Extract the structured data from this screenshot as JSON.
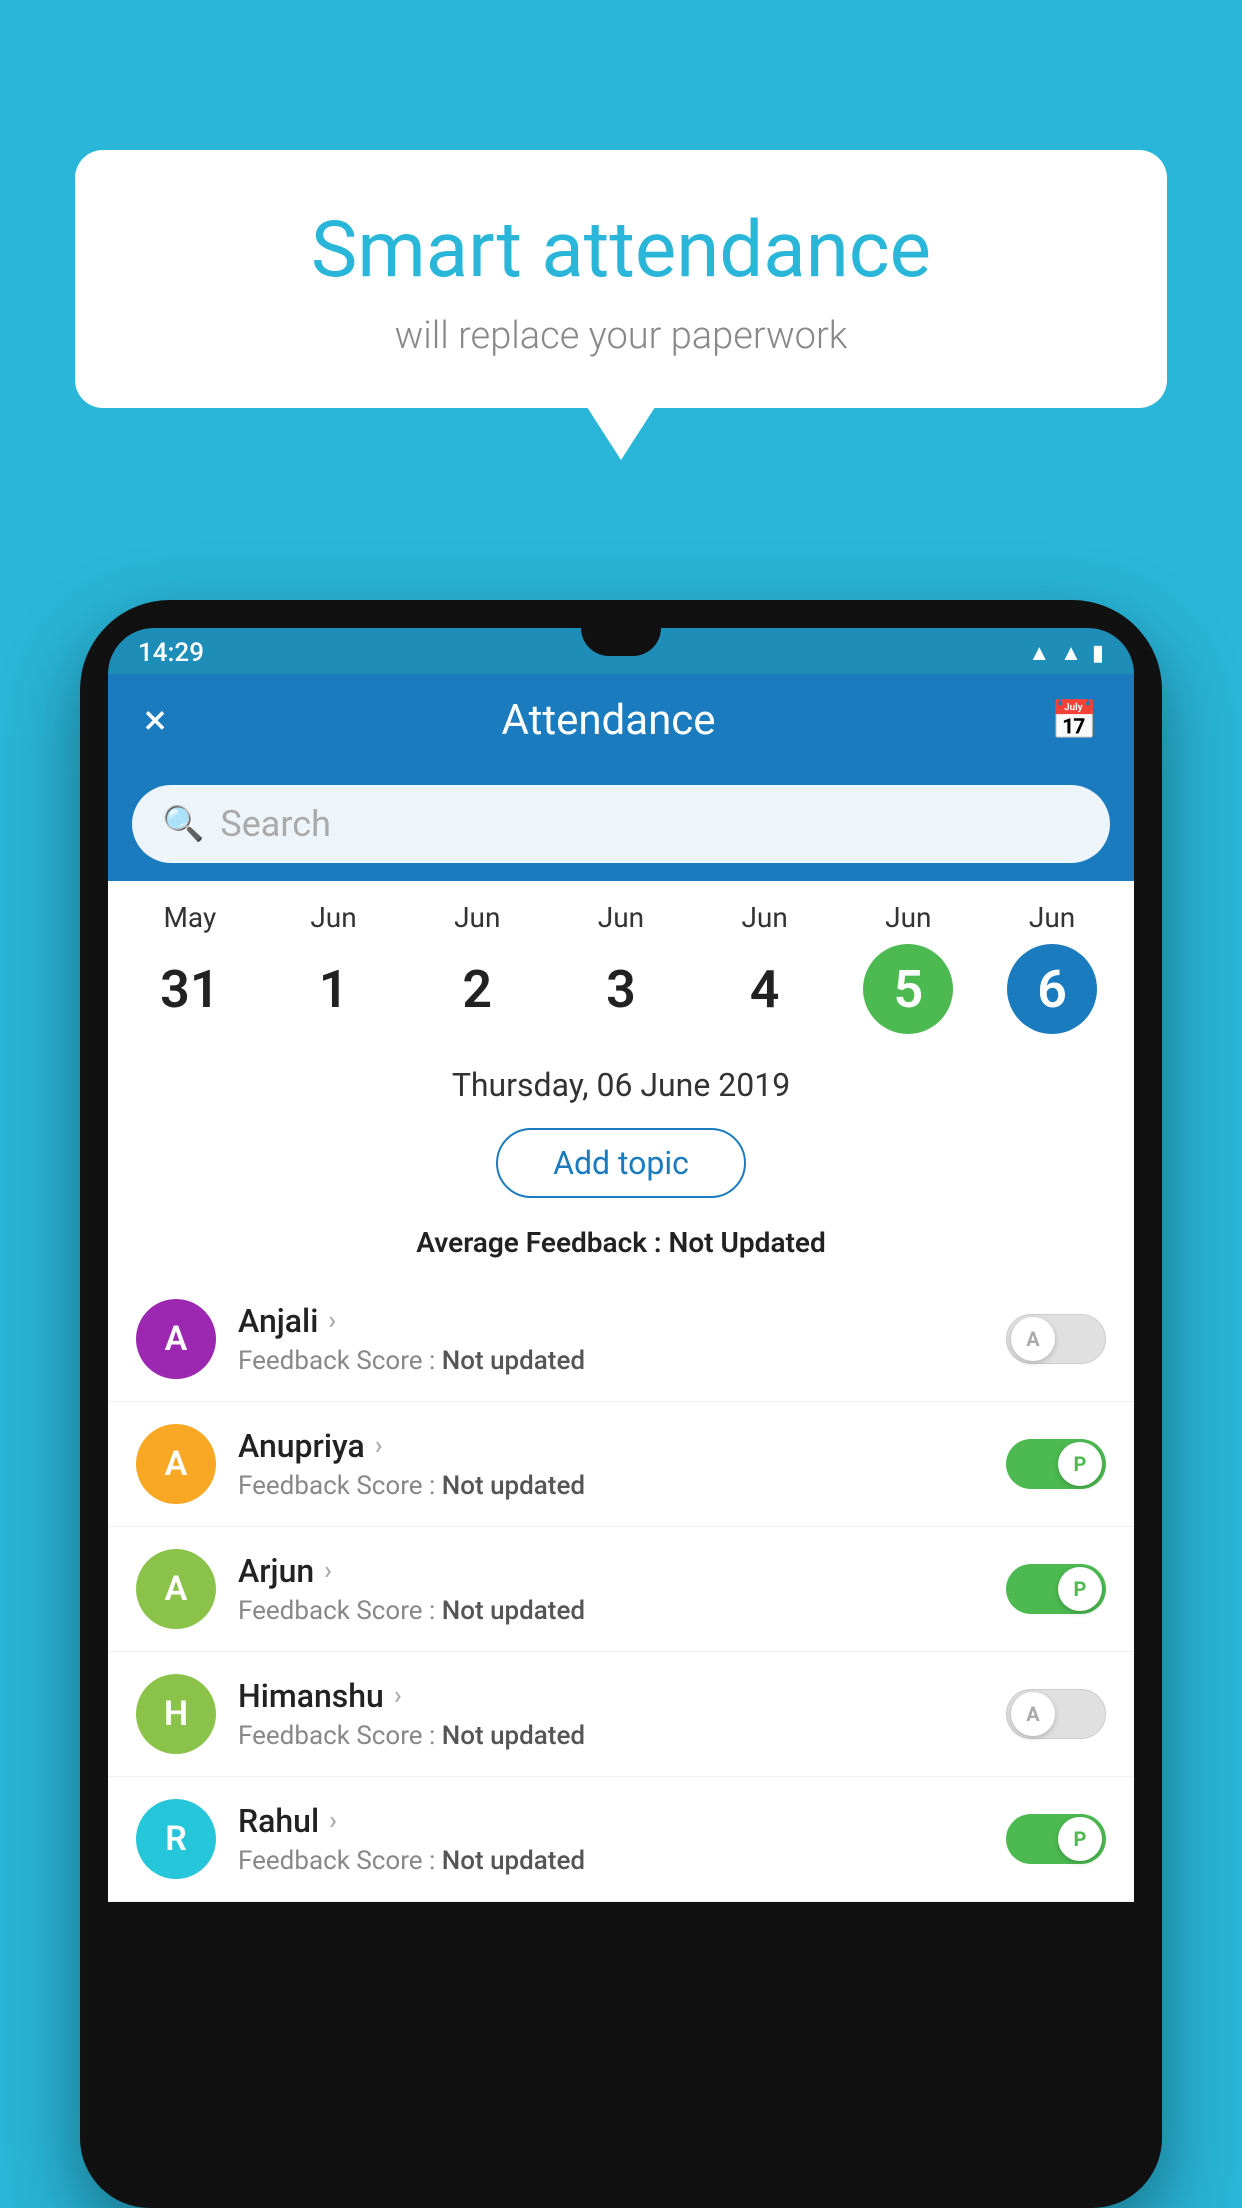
{
  "background_color": "#29b6d8",
  "bubble": {
    "title": "Smart attendance",
    "subtitle": "will replace your paperwork"
  },
  "phone": {
    "time": "14:29",
    "header": {
      "title": "Attendance",
      "close_icon": "×",
      "calendar_icon": "📅"
    },
    "search": {
      "placeholder": "Search"
    },
    "calendar": {
      "days": [
        {
          "month": "May",
          "date": "31",
          "state": "normal"
        },
        {
          "month": "Jun",
          "date": "1",
          "state": "normal"
        },
        {
          "month": "Jun",
          "date": "2",
          "state": "normal"
        },
        {
          "month": "Jun",
          "date": "3",
          "state": "normal"
        },
        {
          "month": "Jun",
          "date": "4",
          "state": "normal"
        },
        {
          "month": "Jun",
          "date": "5",
          "state": "today"
        },
        {
          "month": "Jun",
          "date": "6",
          "state": "selected"
        }
      ]
    },
    "selected_date": "Thursday, 06 June 2019",
    "add_topic_label": "Add topic",
    "avg_feedback_label": "Average Feedback :",
    "avg_feedback_value": "Not Updated",
    "students": [
      {
        "name": "Anjali",
        "avatar_letter": "A",
        "avatar_color": "#9c27b0",
        "feedback_label": "Feedback Score :",
        "feedback_value": "Not updated",
        "toggle_state": "off",
        "toggle_label": "A"
      },
      {
        "name": "Anupriya",
        "avatar_letter": "A",
        "avatar_color": "#f9a825",
        "feedback_label": "Feedback Score :",
        "feedback_value": "Not updated",
        "toggle_state": "on",
        "toggle_label": "P"
      },
      {
        "name": "Arjun",
        "avatar_letter": "A",
        "avatar_color": "#8bc34a",
        "feedback_label": "Feedback Score :",
        "feedback_value": "Not updated",
        "toggle_state": "on",
        "toggle_label": "P"
      },
      {
        "name": "Himanshu",
        "avatar_letter": "H",
        "avatar_color": "#8bc34a",
        "feedback_label": "Feedback Score :",
        "feedback_value": "Not updated",
        "toggle_state": "off",
        "toggle_label": "A"
      },
      {
        "name": "Rahul",
        "avatar_letter": "R",
        "avatar_color": "#26c6da",
        "feedback_label": "Feedback Score :",
        "feedback_value": "Not updated",
        "toggle_state": "on",
        "toggle_label": "P"
      }
    ]
  }
}
